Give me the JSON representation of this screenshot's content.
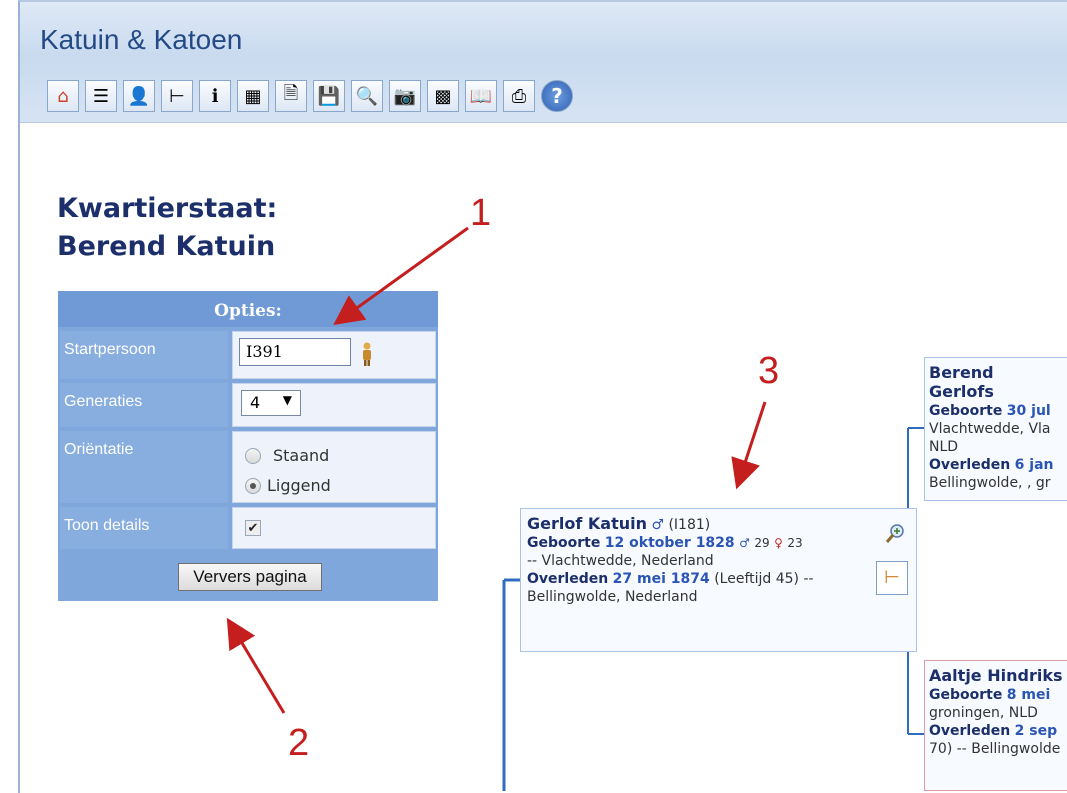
{
  "app": {
    "title": "Katuin & Katoen"
  },
  "toolbar": [
    {
      "icon": "home-icon",
      "glyph": "⌂"
    },
    {
      "icon": "list-icon",
      "glyph": "☰"
    },
    {
      "icon": "people-icon",
      "glyph": "👤"
    },
    {
      "icon": "family-tree-icon",
      "glyph": "⊢"
    },
    {
      "icon": "person-info-icon",
      "glyph": "ℹ"
    },
    {
      "icon": "calendar-icon",
      "glyph": "▦"
    },
    {
      "icon": "document-icon",
      "glyph": "🗎"
    },
    {
      "icon": "save-icon",
      "glyph": "💾"
    },
    {
      "icon": "search-icon",
      "glyph": "🔍"
    },
    {
      "icon": "camera-icon",
      "glyph": "📷"
    },
    {
      "icon": "photos-icon",
      "glyph": "▩"
    },
    {
      "icon": "book-icon",
      "glyph": "📖"
    },
    {
      "icon": "print-icon",
      "glyph": "⎙"
    },
    {
      "icon": "help-icon",
      "glyph": "?"
    }
  ],
  "page": {
    "title_line1": "Kwartierstaat:",
    "title_line2": "Berend Katuin"
  },
  "options": {
    "header": "Opties:",
    "start_label": "Startpersoon",
    "start_value": "I391",
    "gen_label": "Generaties",
    "gen_value": "4",
    "orient_label": "Oriëntatie",
    "orient_opt1": "Staand",
    "orient_opt2": "Liggend",
    "orient_selected": "Liggend",
    "details_label": "Toon details",
    "details_checked": true,
    "refresh_label": "Ververs pagina"
  },
  "annotations": [
    "1",
    "2",
    "3"
  ],
  "center_person": {
    "name": "Gerlof Katuin",
    "id": "(I181)",
    "birth_label": "Geboorte",
    "birth_date": "12 oktober 1828",
    "father_age": "29",
    "mother_age": "23",
    "birth_place": "-- Vlachtwedde, Nederland",
    "death_label": "Overleden",
    "death_date": "27 mei 1874",
    "age_text": "(Leeftijd 45) --",
    "death_place": "Bellingwolde, Nederland"
  },
  "father": {
    "name": "Berend Gerlofs",
    "birth_label": "Geboorte",
    "birth_date": "30 jul",
    "birth_place": "Vlachtwedde, Vla",
    "country": "NLD",
    "death_label": "Overleden",
    "death_date": "6 jan",
    "death_place": "Bellingwolde, , gr"
  },
  "mother": {
    "name": "Aaltje Hindriks",
    "birth_label": "Geboorte",
    "birth_date": "8 mei",
    "birth_place": "groningen, NLD",
    "death_label": "Overleden",
    "death_date": "2 sep",
    "death_place": "70) -- Bellingwolde"
  }
}
